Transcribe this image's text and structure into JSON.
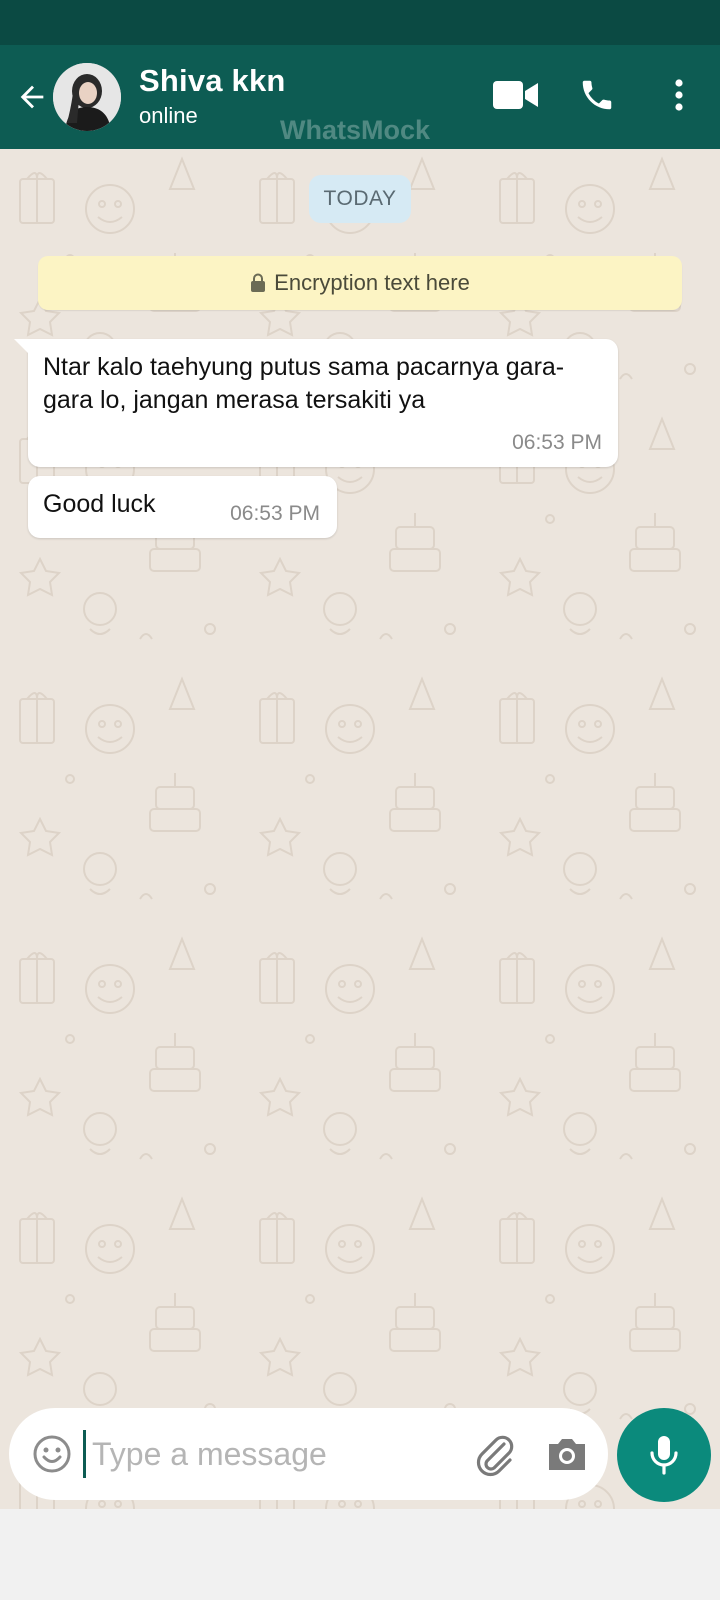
{
  "header": {
    "contact_name": "Shiva kkn",
    "contact_status": "online",
    "watermark": "WhatsMock",
    "icons": [
      "back-arrow-icon",
      "video-call-icon",
      "phone-icon",
      "more-vert-icon"
    ]
  },
  "chat": {
    "date_label": "TODAY",
    "encryption_text": "Encryption text here",
    "messages": [
      {
        "text": "Ntar kalo taehyung putus sama pacarnya gara-gara lo, jangan merasa tersakiti ya",
        "time": "06:53 PM"
      },
      {
        "text": "Good luck",
        "time": "06:53 PM"
      }
    ]
  },
  "composer": {
    "placeholder": "Type a message",
    "icons": [
      "emoji-icon",
      "paperclip-icon",
      "camera-icon",
      "mic-icon"
    ]
  },
  "colors": {
    "header_bg": "#0d5c53",
    "status_bar_bg": "#0b4a43",
    "chat_bg": "#ece5dd",
    "mic_button_bg": "#0b8a7c",
    "date_chip_bg": "#d6eaf4",
    "encryption_bg": "#fcf4c4"
  }
}
